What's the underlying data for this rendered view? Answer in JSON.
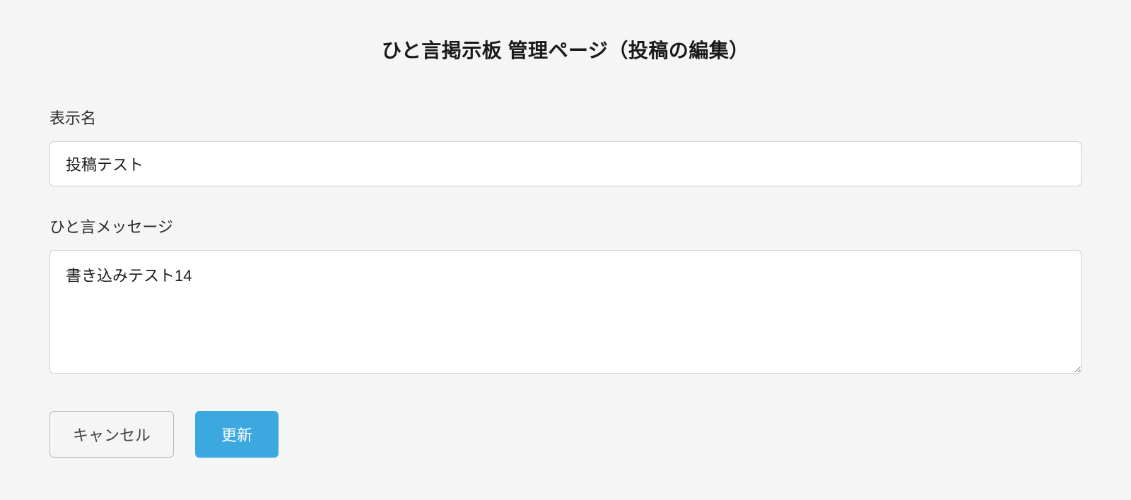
{
  "page": {
    "title": "ひと言掲示板 管理ページ（投稿の編集）"
  },
  "form": {
    "display_name": {
      "label": "表示名",
      "value": "投稿テスト"
    },
    "message": {
      "label": "ひと言メッセージ",
      "value": "書き込みテスト14"
    }
  },
  "buttons": {
    "cancel_label": "キャンセル",
    "update_label": "更新"
  }
}
